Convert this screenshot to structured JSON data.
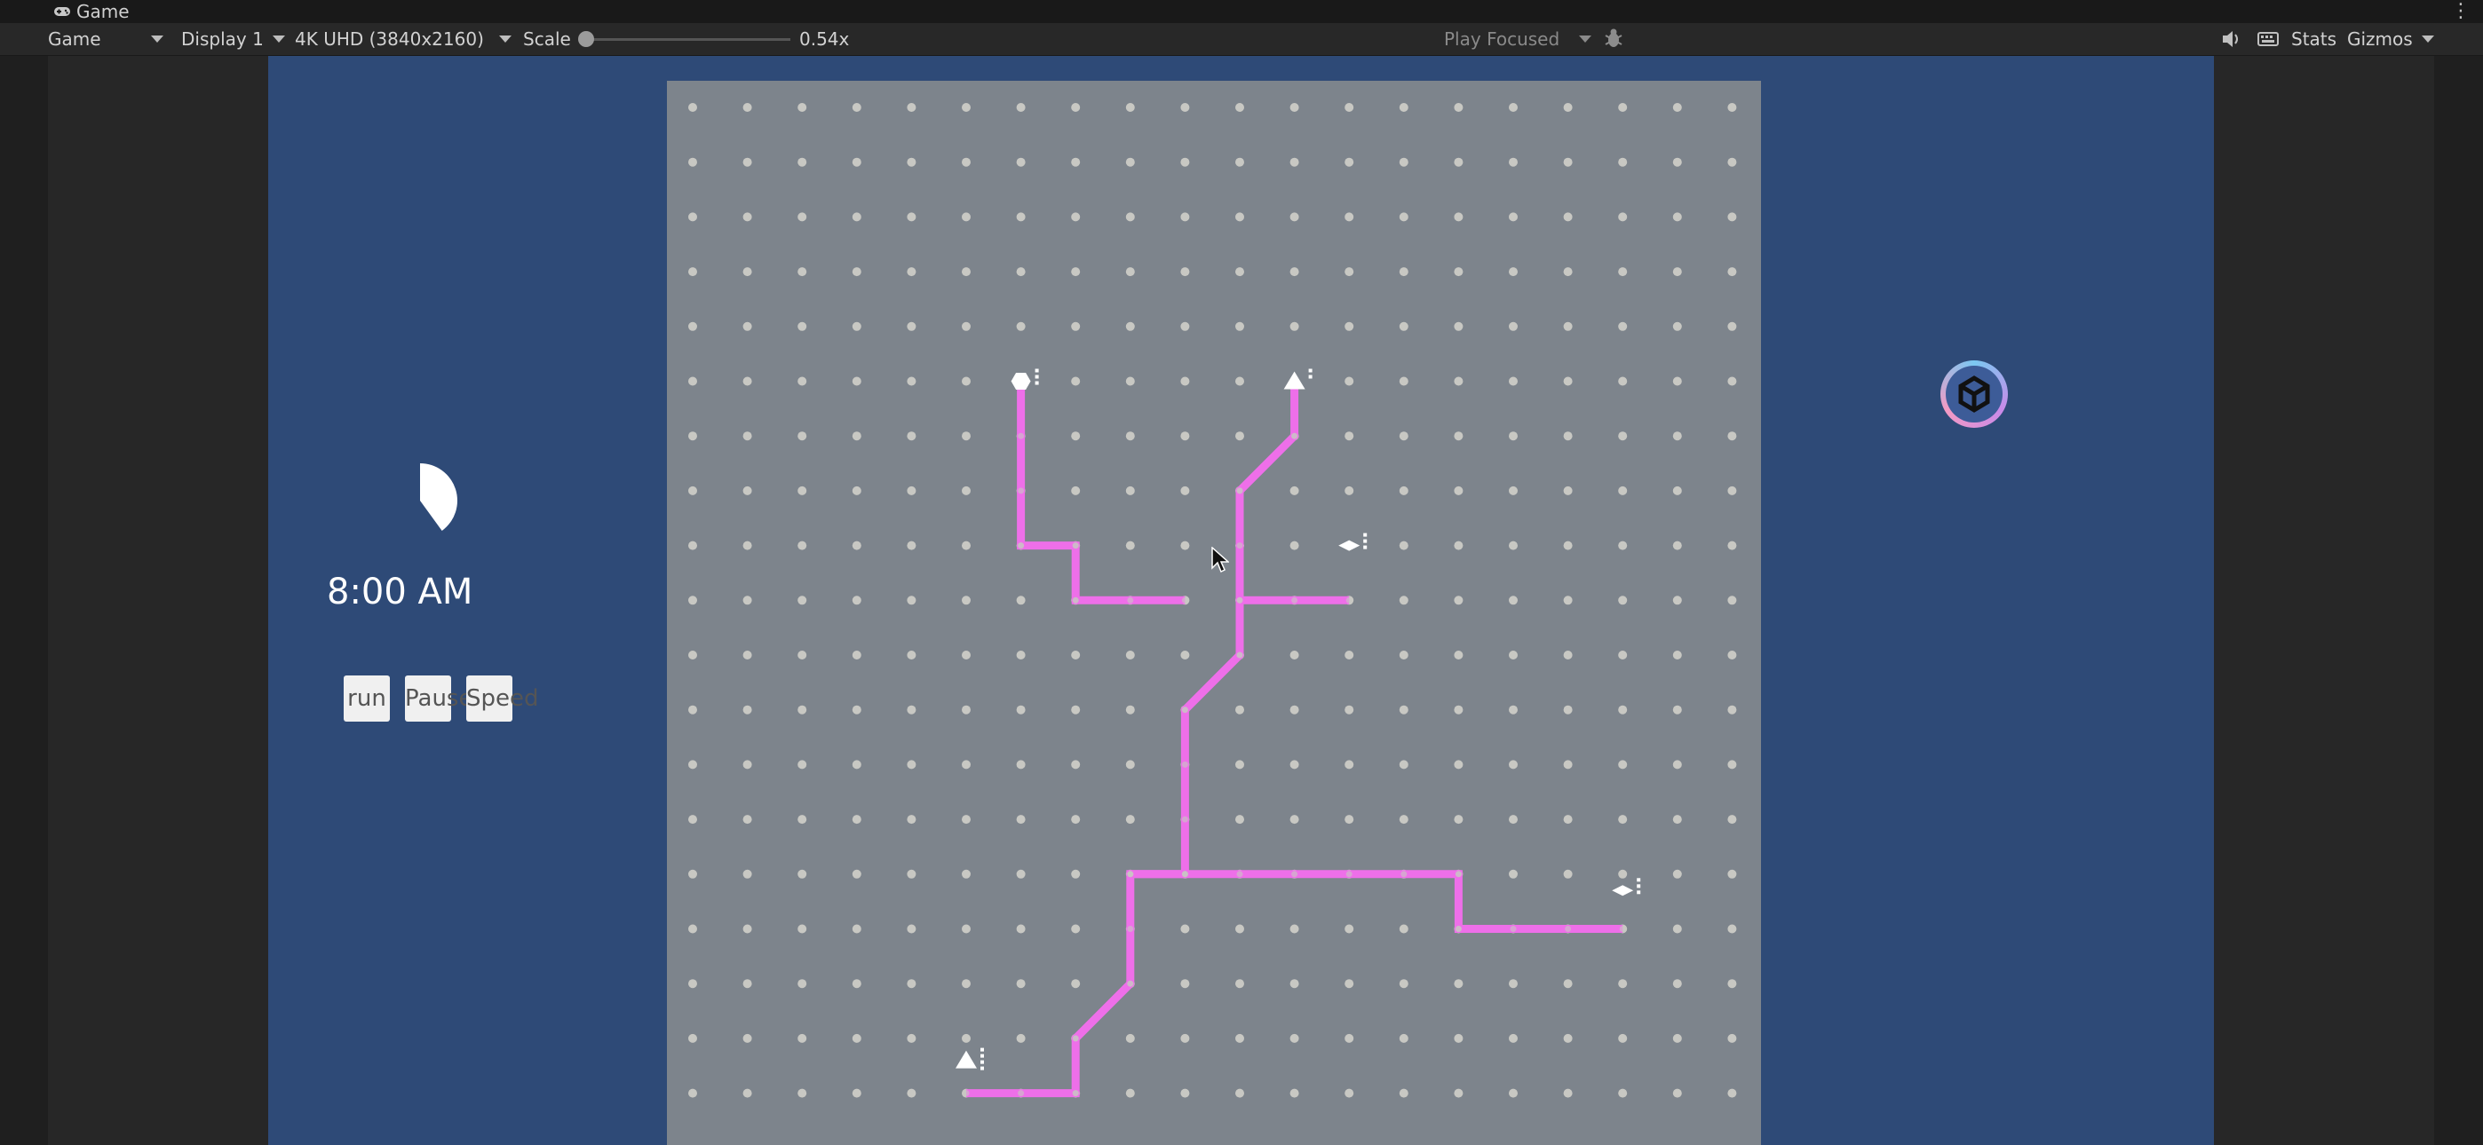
{
  "titlebar": {
    "tab_label": "Game",
    "menu_glyph": "⋮"
  },
  "toolbar": {
    "view_mode": "Game",
    "display": "Display 1",
    "resolution": "4K UHD (3840x2160)",
    "scale_label": "Scale",
    "scale_value": "0.54x",
    "scale_fraction": 0.0,
    "play_mode": "Play Focused",
    "stats_label": "Stats",
    "gizmos_label": "Gizmos",
    "icons": [
      "bug-icon",
      "speaker-icon",
      "keyboard-icon"
    ]
  },
  "hud": {
    "time": "8:00 AM",
    "buttons": [
      "run",
      "Pause",
      "Speed"
    ],
    "clock_fill_fraction": 0.4
  },
  "colors": {
    "game_background": "#2e4a77",
    "board": "#7d848c",
    "track": "#ee6fe9",
    "dot": "#c8c8c3"
  }
}
